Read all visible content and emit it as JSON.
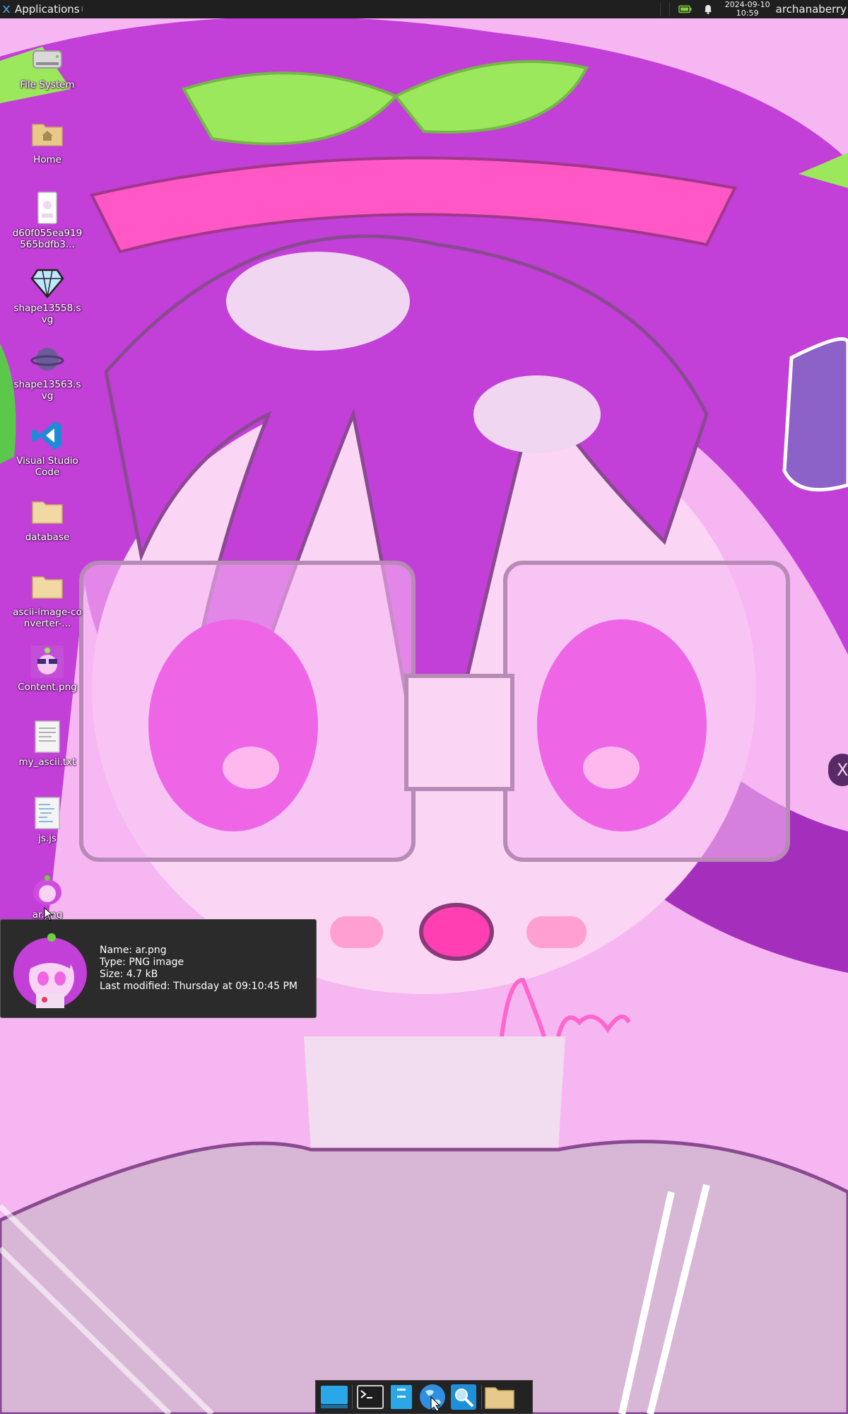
{
  "top_panel": {
    "applications_label": "Applications",
    "date": "2024-09-10",
    "time": "10:59",
    "user": "archanaberry",
    "tray_icons": [
      "battery-icon",
      "notification-bell-icon"
    ]
  },
  "desktop_icons": [
    {
      "label": "File System",
      "icon": "drive-icon"
    },
    {
      "label": "Home",
      "icon": "home-folder-icon"
    },
    {
      "label": "d60f055ea919565bdfb3...",
      "icon": "image-file-icon"
    },
    {
      "label": "shape13558.svg",
      "icon": "diamond-svg-icon"
    },
    {
      "label": "shape13563.svg",
      "icon": "planet-svg-icon"
    },
    {
      "label": "Visual Studio Code",
      "icon": "vscode-icon"
    },
    {
      "label": "database",
      "icon": "folder-icon"
    },
    {
      "label": "ascii-image-converter-...",
      "icon": "folder-icon"
    },
    {
      "label": "Content.png",
      "icon": "image-thumbnail-icon"
    },
    {
      "label": "my_ascii.txt",
      "icon": "text-file-icon"
    },
    {
      "label": "js.js",
      "icon": "script-file-icon"
    },
    {
      "label": "ar.png",
      "icon": "image-thumbnail-icon"
    }
  ],
  "tooltip": {
    "name": "Name: ar.png",
    "type": "Type: PNG image",
    "size": "Size: 4.7 kB",
    "modified": "Last modified: Thursday at 09:10:45 PM"
  },
  "edge_handle": {
    "label": "X"
  },
  "dock": {
    "items": [
      "show-desktop",
      "terminal",
      "file-manager-blue",
      "web-browser",
      "app-finder",
      "files-folder"
    ]
  },
  "colors": {
    "panel_bg": "#1f1f1f",
    "tooltip_bg": "#2b2b2b",
    "wallpaper_purple": "#c23fd8",
    "wallpaper_pink": "#f6b6f2"
  }
}
